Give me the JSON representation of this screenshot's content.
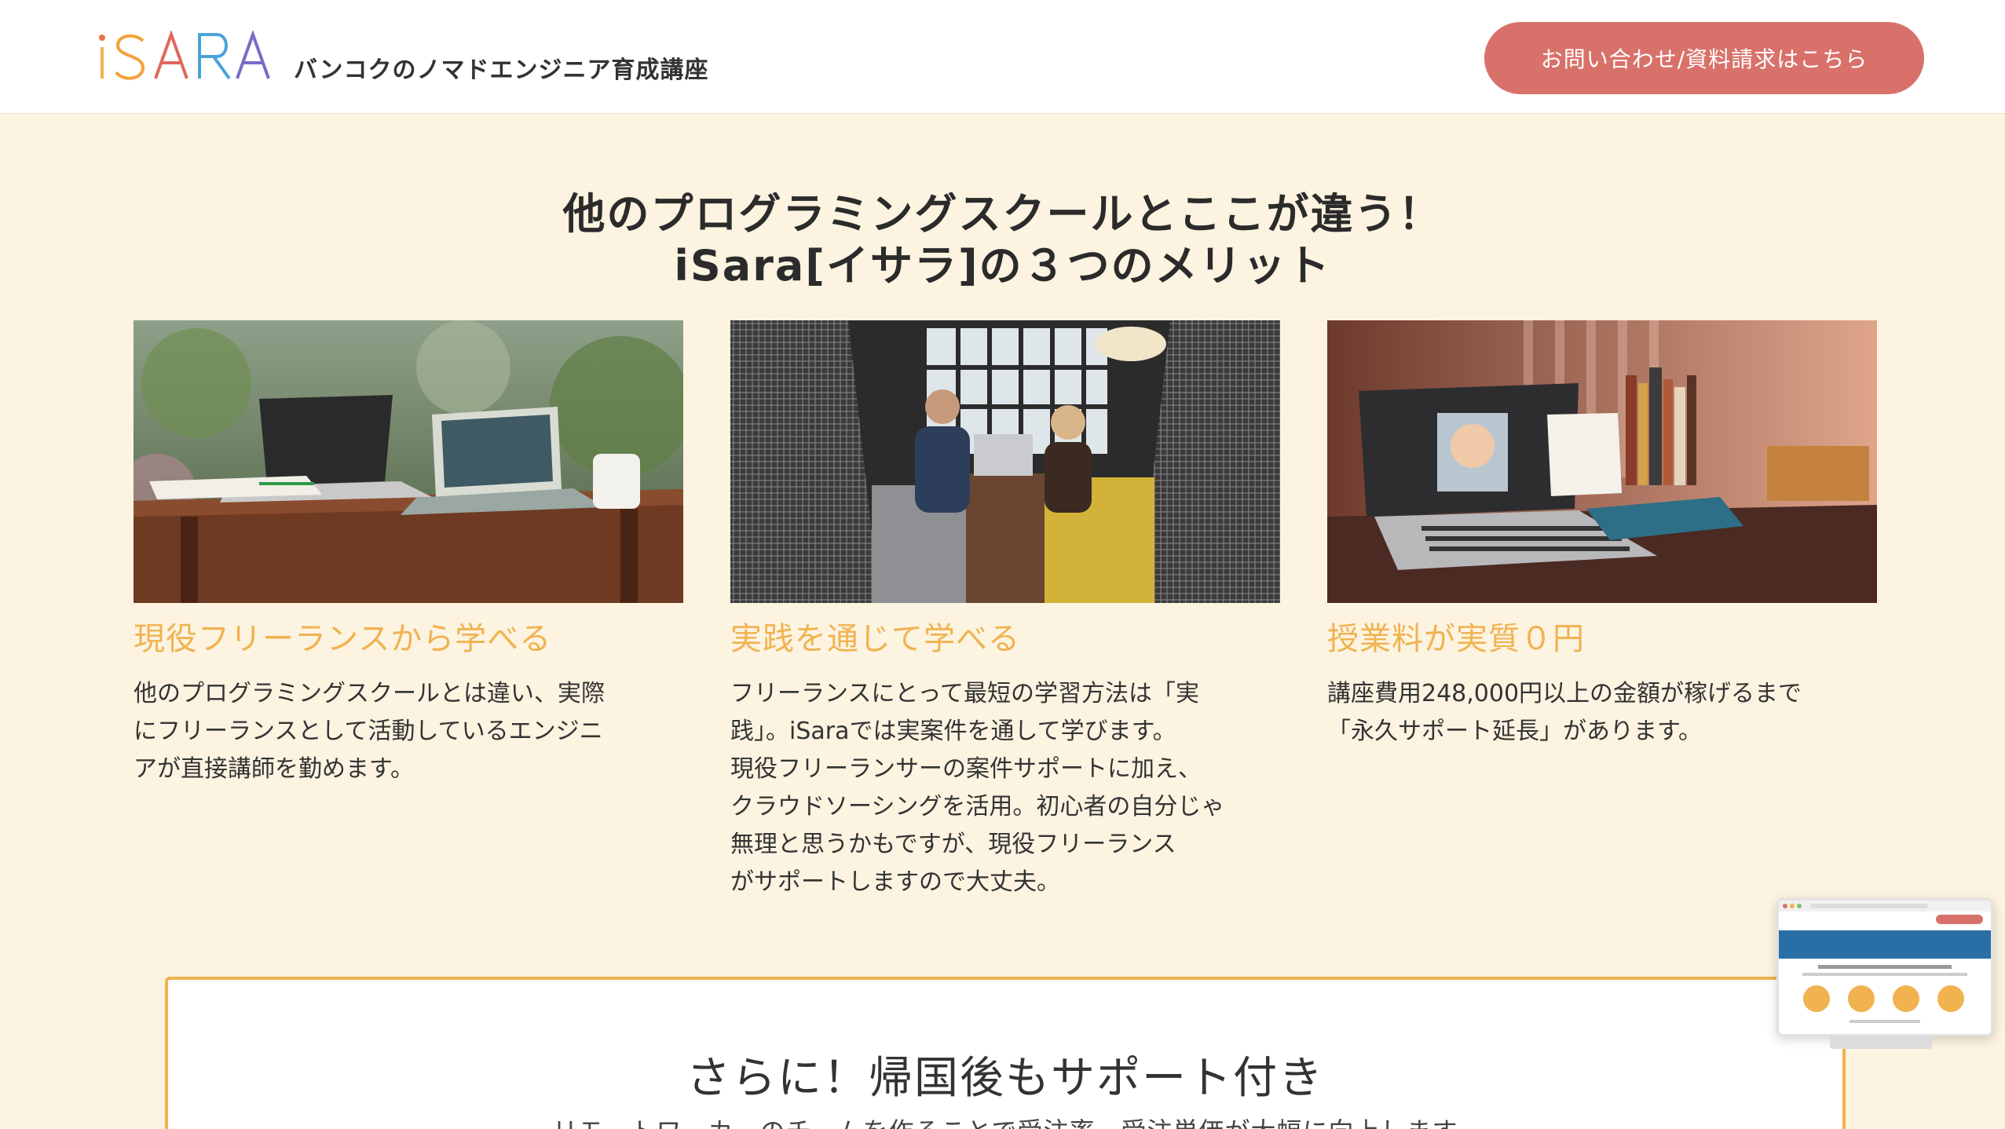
{
  "header": {
    "logo_text": "iSARA",
    "tagline": "バンコクのノマドエンジニア育成講座",
    "cta_label": "お問い合わせ/資料請求はこちら"
  },
  "section": {
    "title_line1": "他のプログラミングスクールとここが違う！",
    "title_line2": "iSara[イサラ]の３つのメリット"
  },
  "merits": [
    {
      "heading": "現役フリーランスから学べる",
      "text": "他のプログラミングスクールとは違い、実際\nにフリーランスとして活動しているエンジニ\nアが直接講師を勤めます。",
      "image": "laptops-on-outdoor-table-photo"
    },
    {
      "heading": "実践を通じて学べる",
      "text": "フリーランスにとって最短の学習方法は「実\n践」。iSaraでは実案件を通して学びます。\n現役フリーランサーの案件サポートに加え、\nクラウドソーシングを活用。初心者の自分じゃ\n無理と思うかもですが、現役フリーランス\nがサポートしますので大丈夫。",
      "image": "two-people-working-on-laptop-photo"
    },
    {
      "heading": "授業料が実質０円",
      "text": "講座費用248,000円以上の金額が稼げるまで\n「永久サポート延長」があります。",
      "image": "laptop-photo-editing-desk-photo"
    }
  ],
  "support": {
    "title": "さらに！帰国後もサポート付き",
    "subtitle": "リモートワーカーのチームを作ることで受注率、受注単価が大幅に向上します"
  },
  "colors": {
    "background": "#fcf3e1",
    "accent_orange": "#f0b34f",
    "cta_red": "#d9716b",
    "text_dark": "#333333"
  }
}
